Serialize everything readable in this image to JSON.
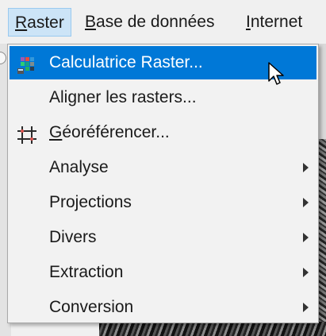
{
  "menubar": {
    "items": [
      {
        "label_first": "R",
        "label_rest": "aster",
        "active": true
      },
      {
        "label_first": "B",
        "label_rest": "ase de données",
        "active": false
      },
      {
        "label_first": "I",
        "label_rest": "nternet",
        "active": false
      }
    ]
  },
  "dropdown": {
    "items": [
      {
        "label": "Calculatrice Raster...",
        "icon": "raster-calculator-icon",
        "highlighted": true,
        "submenu": false
      },
      {
        "label": "Aligner les rasters...",
        "icon": null,
        "highlighted": false,
        "submenu": false
      },
      {
        "label_first": "G",
        "label_rest": "éoréférencer...",
        "icon": "georeferencer-icon",
        "highlighted": false,
        "submenu": false
      },
      {
        "label": "Analyse",
        "icon": null,
        "highlighted": false,
        "submenu": true
      },
      {
        "label": "Projections",
        "icon": null,
        "highlighted": false,
        "submenu": true
      },
      {
        "label": "Divers",
        "icon": null,
        "highlighted": false,
        "submenu": true
      },
      {
        "label": "Extraction",
        "icon": null,
        "highlighted": false,
        "submenu": true
      },
      {
        "label": "Conversion",
        "icon": null,
        "highlighted": false,
        "submenu": true
      }
    ]
  },
  "colors": {
    "highlight": "#0078d7",
    "menubar_active": "#cce4f7",
    "menu_background": "#f2f2f2"
  },
  "cursor": "arrow-pointer-icon"
}
